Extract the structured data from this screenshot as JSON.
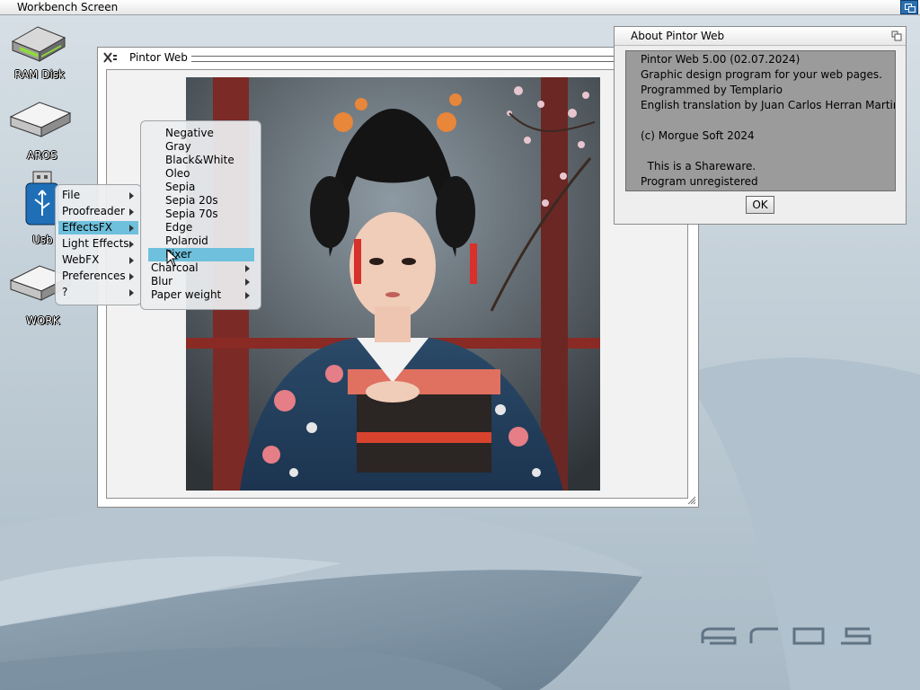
{
  "screen": {
    "title": "Workbench Screen"
  },
  "desktop_icons": [
    {
      "label": "RAM Disk"
    },
    {
      "label": "AROS"
    },
    {
      "label": "Usb"
    },
    {
      "label": "WORK"
    }
  ],
  "pintor_window": {
    "title": "Pintor Web"
  },
  "about_window": {
    "title": "About Pintor Web",
    "lines": [
      "Pintor Web 5.00 (02.07.2024)",
      "Graphic design program for your web pages.",
      "Programmed by Templario",
      "English translation by Juan Carlos Herran Martin.",
      "",
      "(c) Morgue Soft 2024",
      "",
      "  This is a Shareware.",
      "Program unregistered"
    ],
    "ok_label": "OK"
  },
  "main_menu": {
    "items": [
      {
        "label": "File",
        "submenu": true
      },
      {
        "label": "Proofreader",
        "submenu": true
      },
      {
        "label": "EffectsFX",
        "submenu": true,
        "selected": true
      },
      {
        "label": "Light Effects",
        "submenu": true
      },
      {
        "label": "WebFX",
        "submenu": true
      },
      {
        "label": "Preferences",
        "submenu": true
      },
      {
        "label": "?",
        "submenu": true
      }
    ]
  },
  "effects_menu": {
    "items": [
      {
        "label": "Negative"
      },
      {
        "label": "Gray"
      },
      {
        "label": "Black&White"
      },
      {
        "label": "Oleo"
      },
      {
        "label": "Sepia"
      },
      {
        "label": "Sepia 20s"
      },
      {
        "label": "Sepia 70s"
      },
      {
        "label": "Edge"
      },
      {
        "label": "Polaroid"
      },
      {
        "label": "Pixer",
        "selected": true
      },
      {
        "label": "Charcoal",
        "submenu": true
      },
      {
        "label": "Blur",
        "submenu": true
      },
      {
        "label": "Paper weight",
        "submenu": true
      }
    ]
  },
  "branding": {
    "logo_text": "aros"
  },
  "colors": {
    "menu_highlight": "#6ec0dc",
    "depth_button": "#2a6fb0",
    "desktop": "#c3d0d8"
  }
}
